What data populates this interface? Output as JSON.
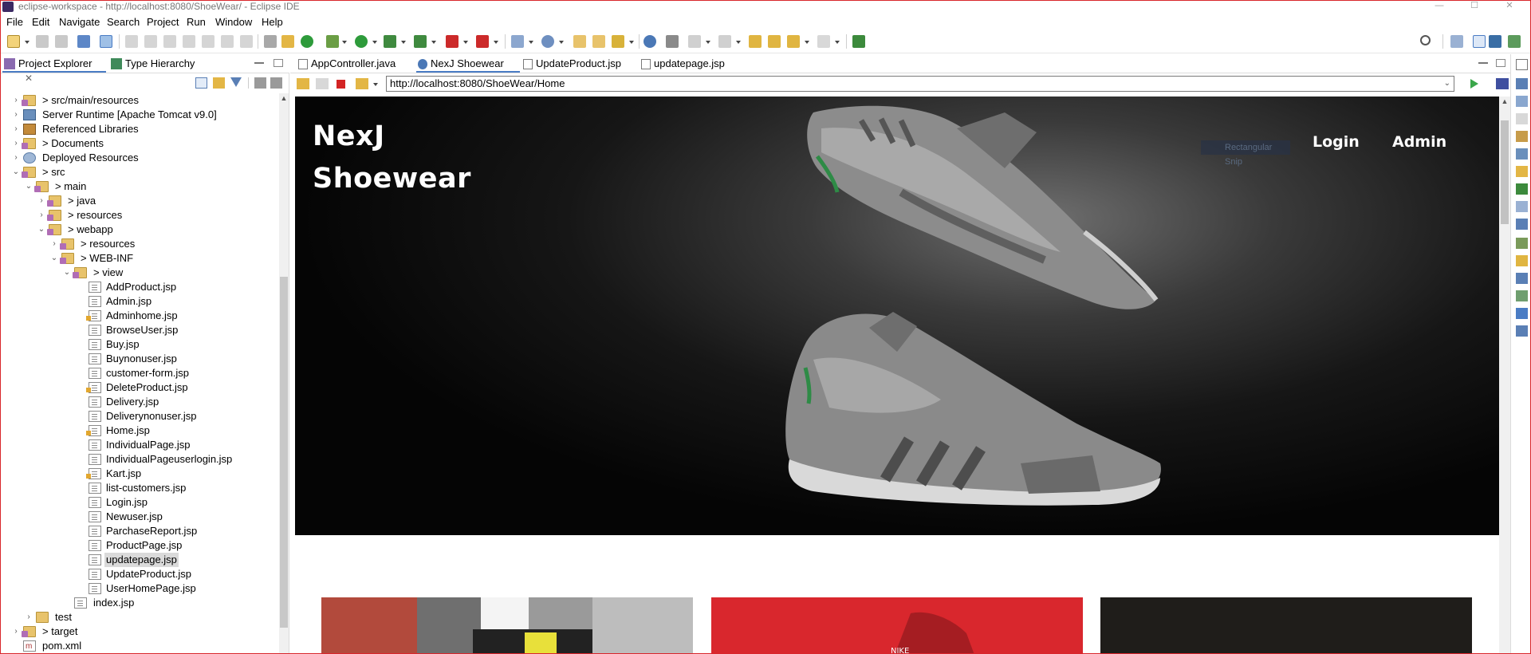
{
  "window": {
    "title": "eclipse-workspace - http://localhost:8080/ShoeWear/ - Eclipse IDE",
    "controls": {
      "minimize": "—",
      "maximize": "☐",
      "close": "✕"
    }
  },
  "menubar": {
    "items": [
      "File",
      "Edit",
      "Navigate",
      "Search",
      "Project",
      "Run",
      "Window",
      "Help"
    ]
  },
  "left_panel": {
    "tabs": [
      {
        "label": "Project Explorer",
        "icon": "project-explorer-icon",
        "active": true,
        "close": "✕"
      },
      {
        "label": "Type Hierarchy",
        "icon": "type-hierarchy-icon",
        "active": false
      }
    ],
    "tree": [
      {
        "label": "> src/main/resources",
        "depth": 1,
        "icon": "package-folder-icon",
        "twisty": "›"
      },
      {
        "label": "Server Runtime [Apache Tomcat v9.0]",
        "depth": 1,
        "icon": "server-icon",
        "twisty": "›"
      },
      {
        "label": "Referenced Libraries",
        "depth": 1,
        "icon": "library-icon",
        "twisty": "›"
      },
      {
        "label": "> Documents",
        "depth": 1,
        "icon": "package-folder-icon",
        "twisty": "›"
      },
      {
        "label": "Deployed Resources",
        "depth": 1,
        "icon": "deployed-resources-icon",
        "twisty": "›"
      },
      {
        "label": "> src",
        "depth": 1,
        "icon": "package-folder-icon",
        "twisty": "⌄"
      },
      {
        "label": "> main",
        "depth": 2,
        "icon": "package-folder-icon",
        "twisty": "⌄"
      },
      {
        "label": "> java",
        "depth": 3,
        "icon": "package-folder-icon",
        "twisty": "›"
      },
      {
        "label": "> resources",
        "depth": 3,
        "icon": "package-folder-icon",
        "twisty": "›"
      },
      {
        "label": "> webapp",
        "depth": 3,
        "icon": "package-folder-icon",
        "twisty": "⌄"
      },
      {
        "label": "> resources",
        "depth": 4,
        "icon": "package-folder-icon",
        "twisty": "›"
      },
      {
        "label": "> WEB-INF",
        "depth": 4,
        "icon": "package-folder-icon",
        "twisty": "⌄"
      },
      {
        "label": "> view",
        "depth": 5,
        "icon": "package-folder-icon",
        "twisty": "⌄"
      },
      {
        "label": "AddProduct.jsp",
        "depth": 6,
        "icon": "jsp-file-icon"
      },
      {
        "label": "Admin.jsp",
        "depth": 6,
        "icon": "jsp-file-icon"
      },
      {
        "label": "Adminhome.jsp",
        "depth": 6,
        "icon": "jsp-file-icon",
        "modified": true
      },
      {
        "label": "BrowseUser.jsp",
        "depth": 6,
        "icon": "jsp-file-icon"
      },
      {
        "label": "Buy.jsp",
        "depth": 6,
        "icon": "jsp-file-icon"
      },
      {
        "label": "Buynonuser.jsp",
        "depth": 6,
        "icon": "jsp-file-icon"
      },
      {
        "label": "customer-form.jsp",
        "depth": 6,
        "icon": "jsp-file-icon"
      },
      {
        "label": "DeleteProduct.jsp",
        "depth": 6,
        "icon": "jsp-file-icon",
        "modified": true
      },
      {
        "label": "Delivery.jsp",
        "depth": 6,
        "icon": "jsp-file-icon"
      },
      {
        "label": "Deliverynonuser.jsp",
        "depth": 6,
        "icon": "jsp-file-icon"
      },
      {
        "label": "Home.jsp",
        "depth": 6,
        "icon": "jsp-file-icon",
        "modified": true
      },
      {
        "label": "IndividualPage.jsp",
        "depth": 6,
        "icon": "jsp-file-icon"
      },
      {
        "label": "IndividualPageuserlogin.jsp",
        "depth": 6,
        "icon": "jsp-file-icon"
      },
      {
        "label": "Kart.jsp",
        "depth": 6,
        "icon": "jsp-file-icon",
        "modified": true
      },
      {
        "label": "list-customers.jsp",
        "depth": 6,
        "icon": "jsp-file-icon"
      },
      {
        "label": "Login.jsp",
        "depth": 6,
        "icon": "jsp-file-icon"
      },
      {
        "label": "Newuser.jsp",
        "depth": 6,
        "icon": "jsp-file-icon"
      },
      {
        "label": "ParchaseReport.jsp",
        "depth": 6,
        "icon": "jsp-file-icon"
      },
      {
        "label": "ProductPage.jsp",
        "depth": 6,
        "icon": "jsp-file-icon"
      },
      {
        "label": "updatepage.jsp",
        "depth": 6,
        "icon": "jsp-file-icon",
        "selected": true
      },
      {
        "label": "UpdateProduct.jsp",
        "depth": 6,
        "icon": "jsp-file-icon"
      },
      {
        "label": "UserHomePage.jsp",
        "depth": 6,
        "icon": "jsp-file-icon"
      },
      {
        "label": "index.jsp",
        "depth": 5,
        "icon": "jsp-file-icon"
      },
      {
        "label": "test",
        "depth": 2,
        "icon": "folder-icon",
        "twisty": "›"
      },
      {
        "label": "> target",
        "depth": 1,
        "icon": "package-folder-icon",
        "twisty": "›"
      },
      {
        "label": "pom.xml",
        "depth": 1,
        "icon": "xml-file-icon"
      }
    ]
  },
  "editor": {
    "tabs": [
      {
        "label": "AppController.java",
        "icon": "java-file-icon",
        "active": false
      },
      {
        "label": "NexJ Shoewear",
        "icon": "globe-icon",
        "active": true,
        "close": "✕"
      },
      {
        "label": "UpdateProduct.jsp",
        "icon": "jsp-file-icon",
        "active": false
      },
      {
        "label": "updatepage.jsp",
        "icon": "jsp-file-icon",
        "active": false
      }
    ],
    "browser": {
      "url": "http://localhost:8080/ShoeWear/Home",
      "dropdown": "⌄"
    }
  },
  "webpage": {
    "brand_line1": "NexJ",
    "brand_line2": "Shoewear",
    "nav": {
      "login": "Login",
      "admin": "Admin"
    },
    "ghost_text": "Rectangular Snip",
    "card_colors": [
      "#8b8b8b",
      "#d9272d",
      "#1f1d1a"
    ]
  },
  "colors": {
    "accent_blue": "#4a7cc4",
    "frame_red": "#d9262c",
    "hero_bg": "#050505"
  }
}
